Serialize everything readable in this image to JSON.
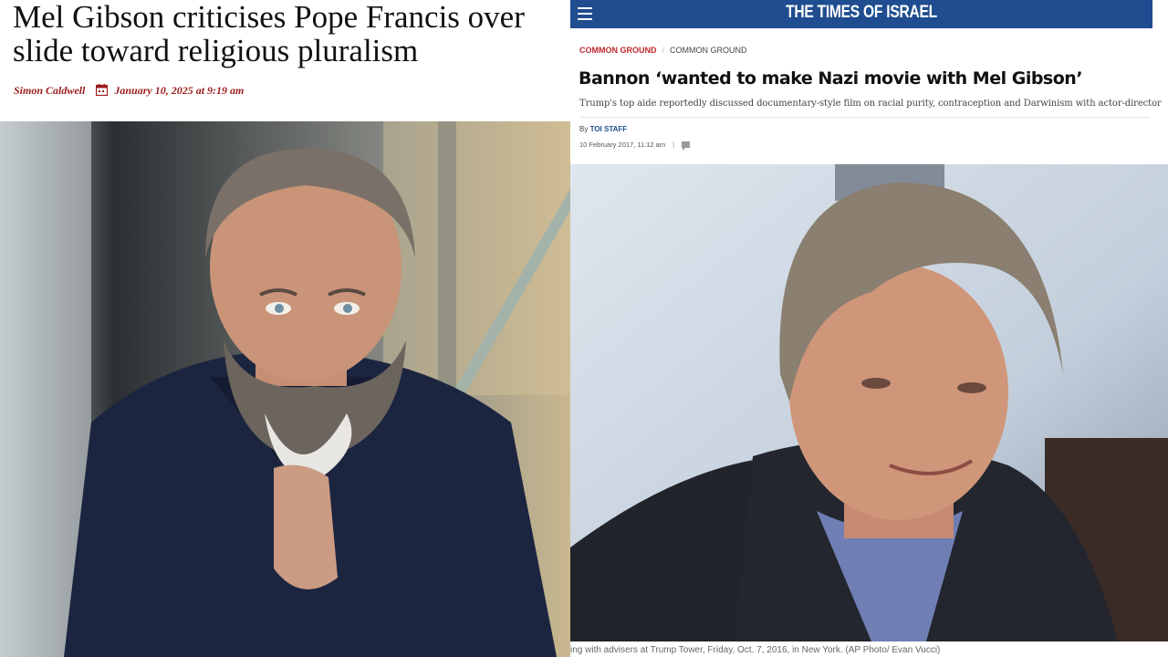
{
  "left_article": {
    "headline": "Mel Gibson criticises Pope Francis over slide toward religious pluralism",
    "author": "Simon Caldwell",
    "date": "January 10, 2025 at 9:19 am",
    "accent_color": "#9b1b1b",
    "photo_icon": "photo-of-bearded-man"
  },
  "right_article": {
    "site_name": "THE TIMES OF ISRAEL",
    "brand_color": "#1f4d8f",
    "category_primary": "COMMON GROUND",
    "category_secondary": "COMMON GROUND",
    "headline": "Bannon ‘wanted to make Nazi movie with Mel Gibson’",
    "subheadline": "Trump's top aide reportedly discussed documentary-style film on racial purity, contraception and Darwinism with actor-director",
    "by_prefix": "By",
    "author": "TOI STAFF",
    "date": "10 February 2017, 11:12 am",
    "divider": "|",
    "caption": "ing with advisers at Trump Tower, Friday, Oct. 7, 2016, in New York. (AP Photo/ Evan Vucci)",
    "photo_icon": "photo-of-smiling-man"
  }
}
